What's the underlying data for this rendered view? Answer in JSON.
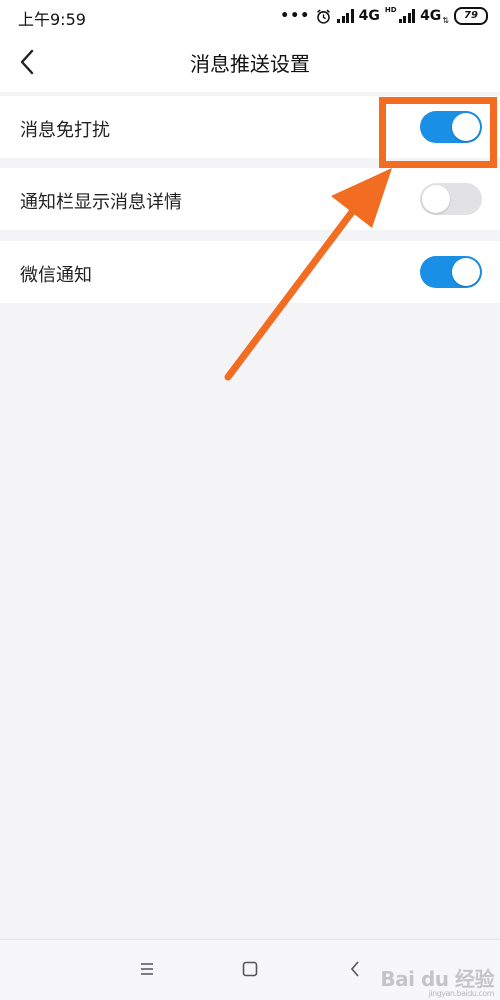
{
  "status_bar": {
    "time": "上午9:59",
    "dots": "•••",
    "network_1": "4G",
    "hd": "HD",
    "network_2": "4G",
    "battery": "79"
  },
  "nav": {
    "title": "消息推送设置"
  },
  "settings": [
    {
      "label": "消息免打扰",
      "enabled": true
    },
    {
      "label": "通知栏显示消息详情",
      "enabled": false
    },
    {
      "label": "微信通知",
      "enabled": true
    }
  ],
  "colors": {
    "accent": "#1a8fe6",
    "toggle_off": "#e2e2e4",
    "annotation": "#f26d21",
    "background": "#f4f4f6"
  },
  "watermark": {
    "text": "Bai du 经验",
    "sub": "jingyan.baidu.com"
  }
}
